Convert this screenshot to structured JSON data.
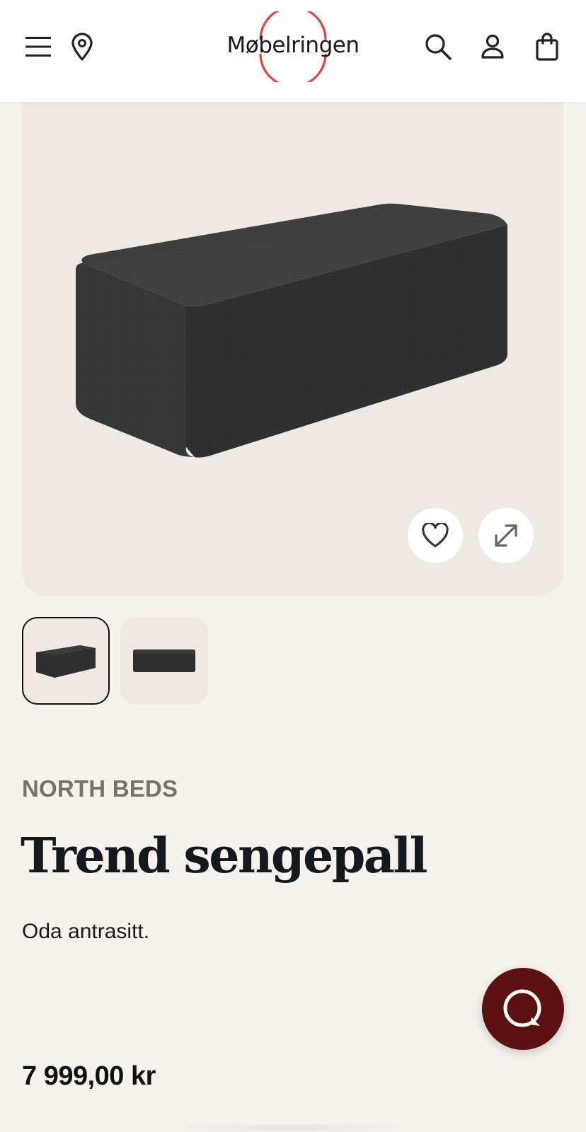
{
  "header": {
    "logo_text": "Møbelringen",
    "icons": [
      "menu-icon",
      "location-pin-icon",
      "search-icon",
      "user-icon",
      "shopping-bag-icon"
    ]
  },
  "product": {
    "brand": "NORTH BEDS",
    "title": "Trend sengepall",
    "description": "Oda antrasitt.",
    "price": "7 999,00 kr",
    "image_actions": [
      "heart-icon",
      "expand-icon"
    ],
    "thumbnails": 2,
    "selected_thumbnail": 1
  },
  "colors": {
    "page_bg": "#f6f2ee",
    "image_bg": "#eeeae3",
    "logo_ring": "#e0453f",
    "chat_button": "#5b1012",
    "brand_text": "#77726d"
  }
}
